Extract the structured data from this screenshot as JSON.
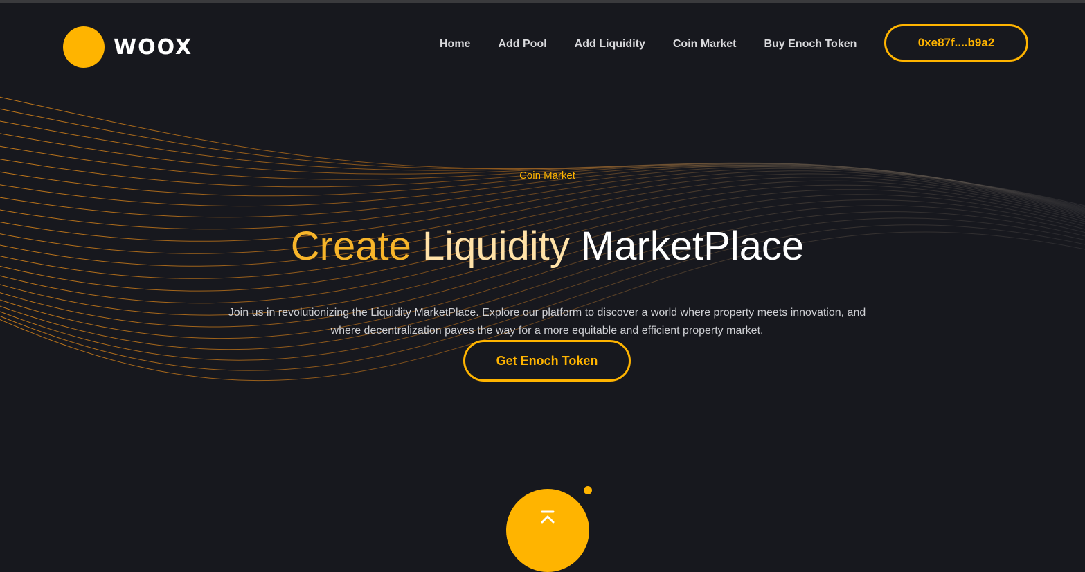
{
  "header": {
    "logo_text": "WOOX",
    "nav": [
      "Home",
      "Add Pool",
      "Add Liquidity",
      "Coin Market",
      "Buy Enoch Token"
    ],
    "wallet_label": "0xe87f....b9a2"
  },
  "hero": {
    "kicker": "Coin Market",
    "title_word_1": "Create",
    "title_word_2": "Liquidity",
    "title_word_3": "MarketPlace",
    "text_line_1": "Join us in revolutionizing the Liquidity MarketPlace. Explore our platform to discover a world where property meets innovation, and",
    "text_line_2": "where decentralization paves the way for a more equitable and efficient property market.",
    "cta_label": "Get Enoch Token"
  },
  "colors": {
    "accent": "#ffb400",
    "background": "#17181e",
    "nav_text": "#d9d9dc"
  },
  "icons": {
    "logo": "yellow-circle",
    "scroll_top": "chevron-up-icon"
  }
}
